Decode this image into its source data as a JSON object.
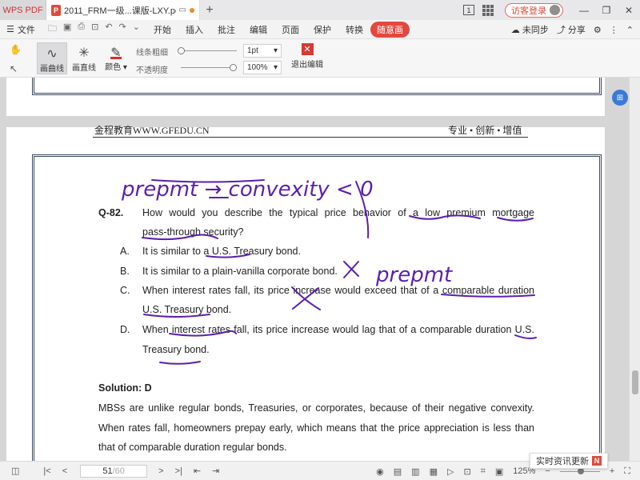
{
  "titlebar": {
    "app_name": "WPS PDF",
    "doc_tab_title": "2011_FRM一级...课版-LXY.pdf",
    "new_tab": "+",
    "page_badge": "1",
    "visitor_label": "访客登录"
  },
  "menubar": {
    "file": "文件",
    "items": [
      "开始",
      "插入",
      "批注",
      "编辑",
      "页面",
      "保护",
      "转换",
      "随意画"
    ],
    "sync": "未同步",
    "share": "分享"
  },
  "toolbar": {
    "curve": "画曲线",
    "line": "画直线",
    "color": "颜色",
    "thickness_label": "线条粗细",
    "opacity_label": "不透明度",
    "thickness_value": "1pt",
    "opacity_value": "100%",
    "exit": "退出编辑"
  },
  "page": {
    "header_left": "金程教育WWW.GFEDU.CN",
    "header_right": "专业 • 创新 • 增值",
    "question_label": "Q-82.",
    "question_line1": "How would you describe the typical price behavior of a low premium mortgage",
    "question_line2": "pass-through security?",
    "options": [
      {
        "label": "A.",
        "line1": "It is similar to a U.S. Treasury bond.",
        "line2": ""
      },
      {
        "label": "B.",
        "line1": "It is similar to a plain-vanilla corporate bond.",
        "line2": ""
      },
      {
        "label": "C.",
        "line1": "When interest rates fall, its price increase would exceed that of a comparable duration",
        "line2": "U.S. Treasury bond."
      },
      {
        "label": "D.",
        "line1": "When interest rates fall, its price increase would lag that of a comparable duration U.S.",
        "line2": "Treasury bond."
      }
    ],
    "solution": "Solution: D",
    "solution_lines": [
      "MBSs are unlike regular bonds, Treasuries, or corporates, because of their negative convexity.",
      "When rates fall, homeowners prepay early, which means that the price appreciation is less than",
      "that of comparable duration regular bonds."
    ],
    "ink_notes": {
      "top": "prepmt → convexity < 0",
      "cross": "X",
      "side": "prepmt"
    }
  },
  "statusbar": {
    "current_page": "51",
    "total_pages": "/60",
    "zoom": "125%",
    "toast": "实时资讯更新",
    "toast_badge": "N"
  },
  "colors": {
    "ink": "#5b1fae",
    "accent": "#e3483f"
  }
}
